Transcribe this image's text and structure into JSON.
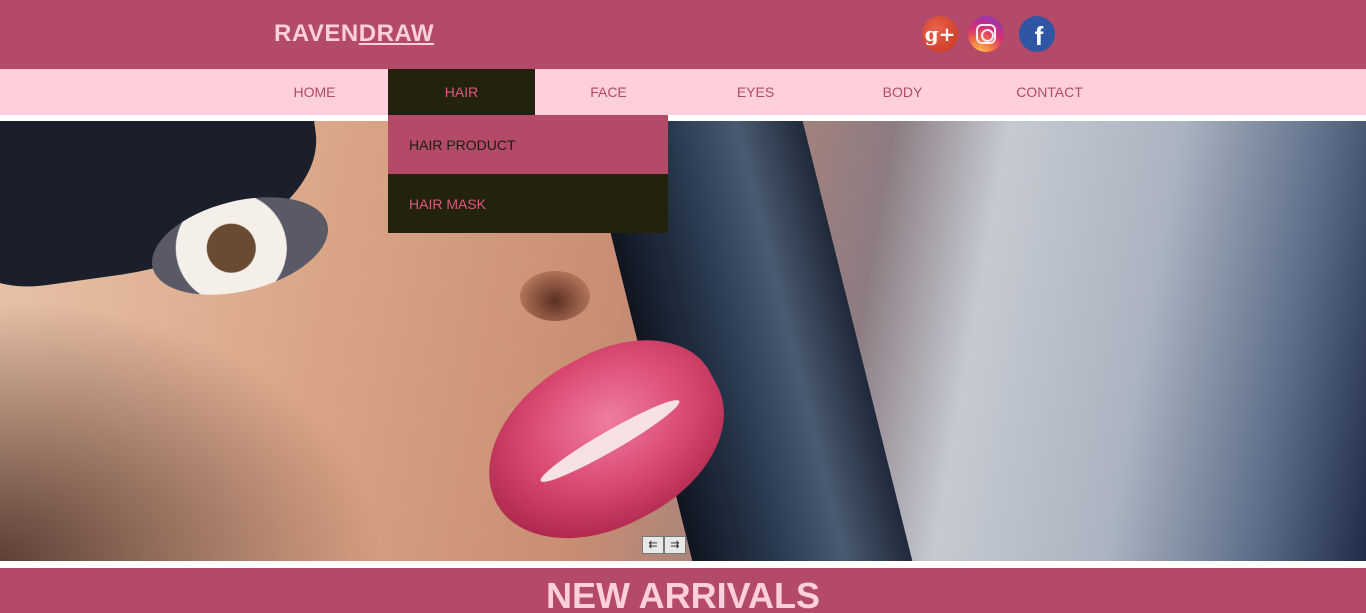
{
  "brand": {
    "logo_part1": "RAVEN",
    "logo_part2": "DRAW"
  },
  "social": [
    {
      "name": "google-plus",
      "glyph": "g+"
    },
    {
      "name": "instagram",
      "glyph": ""
    },
    {
      "name": "facebook",
      "glyph": "f"
    }
  ],
  "nav": {
    "items": [
      {
        "label": "HOME",
        "active": false
      },
      {
        "label": "HAIR",
        "active": true
      },
      {
        "label": "FACE",
        "active": false
      },
      {
        "label": "EYES",
        "active": false
      },
      {
        "label": "BODY",
        "active": false
      },
      {
        "label": "CONTACT",
        "active": false
      }
    ]
  },
  "dropdown": {
    "items": [
      {
        "label": "HAIR PRODUCT"
      },
      {
        "label": "HAIR MASK"
      }
    ]
  },
  "slider": {
    "prev_glyph": "⇇",
    "next_glyph": "⇉"
  },
  "section": {
    "title": "NEW ARRIVALS"
  },
  "colors": {
    "header": "#b34a67",
    "nav": "#ffd0dc",
    "active": "#22220f",
    "accent": "#e0587c"
  }
}
